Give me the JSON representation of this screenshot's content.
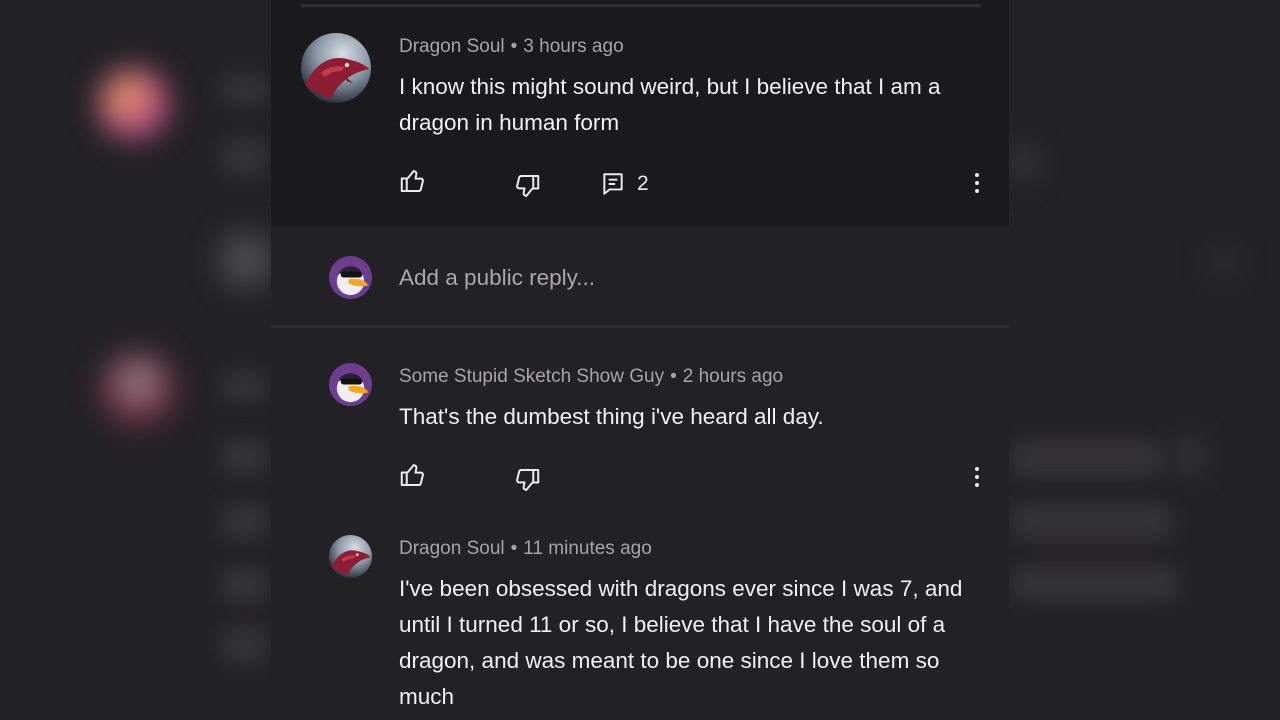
{
  "comment": {
    "author": "Dragon Soul",
    "time": "3 hours ago",
    "text": "I know this might sound weird, but I believe that I am a dragon in human form",
    "reply_count": "2",
    "icons": [
      "like-icon",
      "dislike-icon",
      "reply-icon",
      "more-vert-icon"
    ]
  },
  "reply_input": {
    "placeholder": "Add a public reply..."
  },
  "replies": [
    {
      "author": "Some Stupid Sketch Show Guy",
      "time": "2 hours ago",
      "text": "That's the dumbest thing i've heard all day."
    },
    {
      "author": "Dragon Soul",
      "time": "11 minutes ago",
      "text": "I've been obsessed with dragons ever since I was 7, and until I turned 11 or so, I believe that I have the soul of a dragon, and was meant to be one since I love them so much"
    }
  ],
  "separator": "•",
  "colors": {
    "background": "#1c1b1e",
    "panel": "#1b1a1d",
    "reply_area": "#222125",
    "text_primary": "#f1f0f2",
    "text_secondary": "#a6a4a8"
  }
}
